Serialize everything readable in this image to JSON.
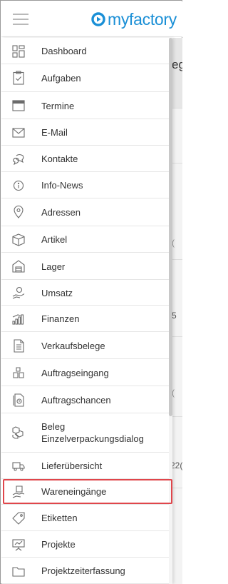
{
  "header": {
    "logo_text": "myfactory",
    "brand_color": "#1a8fd6"
  },
  "menu": {
    "items": [
      {
        "label": "Dashboard",
        "icon": "dashboard-icon"
      },
      {
        "label": "Aufgaben",
        "icon": "clipboard-check-icon"
      },
      {
        "label": "Termine",
        "icon": "calendar-icon"
      },
      {
        "label": "E-Mail",
        "icon": "envelope-icon"
      },
      {
        "label": "Kontakte",
        "icon": "contacts-icon"
      },
      {
        "label": "Info-News",
        "icon": "info-icon"
      },
      {
        "label": "Adressen",
        "icon": "location-pin-icon"
      },
      {
        "label": "Artikel",
        "icon": "box-icon"
      },
      {
        "label": "Lager",
        "icon": "warehouse-icon"
      },
      {
        "label": "Umsatz",
        "icon": "hand-coins-icon"
      },
      {
        "label": "Finanzen",
        "icon": "bar-chart-icon"
      },
      {
        "label": "Verkaufsbelege",
        "icon": "document-icon"
      },
      {
        "label": "Auftragseingang",
        "icon": "boxes-icon"
      },
      {
        "label": "Auftragschancen",
        "icon": "document-chance-icon"
      },
      {
        "label_line1": "Beleg",
        "label_line2": "Einzelverpackungsdialog",
        "icon": "packages-icon"
      },
      {
        "label": "Lieferübersicht",
        "icon": "truck-icon"
      },
      {
        "label": "Wareneingänge",
        "icon": "goods-receipt-icon"
      },
      {
        "label": "Etiketten",
        "icon": "tag-icon"
      },
      {
        "label": "Projekte",
        "icon": "presentation-icon"
      },
      {
        "label": "Projektzeiterfassung",
        "icon": "folder-icon"
      }
    ],
    "highlighted_item": "Wareneingänge",
    "highlight_color": "#e0464b"
  },
  "background": {
    "fragments": [
      "eg",
      "(",
      "5",
      "(",
      "22("
    ]
  }
}
